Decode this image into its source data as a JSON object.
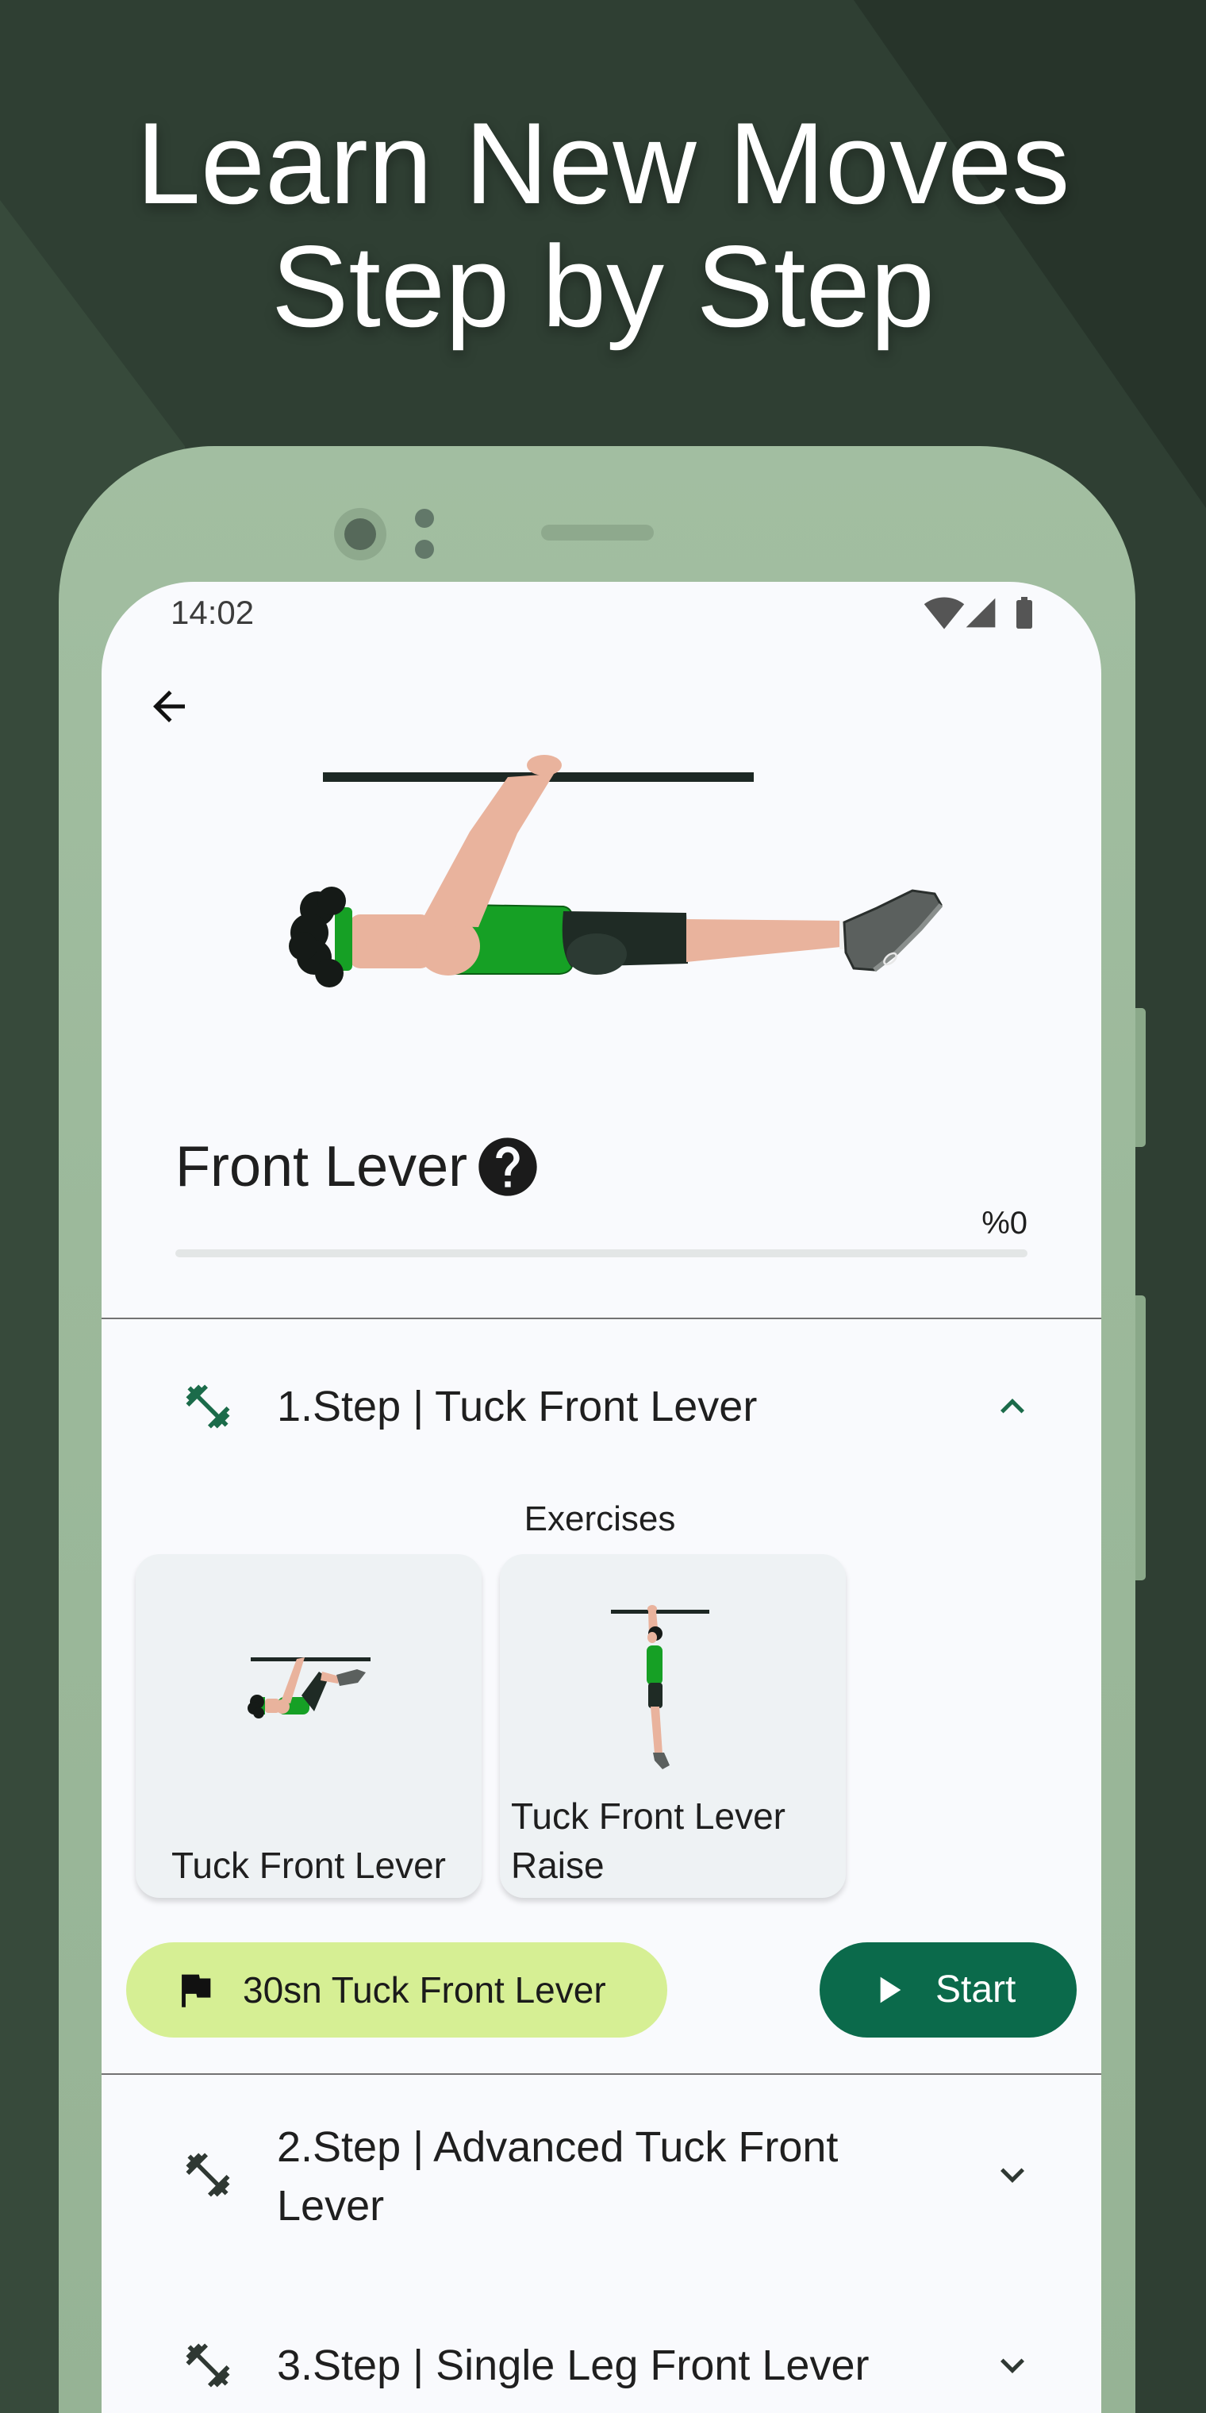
{
  "headline": {
    "line1": "Learn New Moves",
    "line2": "Step by Step"
  },
  "status_bar": {
    "time": "14:02",
    "icons": [
      "wifi-icon",
      "cellular-signal-icon",
      "battery-icon"
    ]
  },
  "toolbar": {
    "back_icon": "arrow-back-icon"
  },
  "skill": {
    "title": "Front Lever",
    "help_icon": "help-circle-icon",
    "progress_label": "%0",
    "progress": 0
  },
  "steps": [
    {
      "label": "1.Step | Tuck Front Lever",
      "icon": "dumbbell-icon",
      "expanded": true,
      "toggle_icon": "chevron-up-icon",
      "exercises_heading": "Exercises",
      "exercises": [
        {
          "label": "Tuck Front Lever"
        },
        {
          "label": "Tuck Front Lever Raise"
        }
      ],
      "goal": {
        "icon": "flag-icon",
        "label": "30sn Tuck Front Lever"
      },
      "start": {
        "icon": "play-icon",
        "label": "Start"
      }
    },
    {
      "label": "2.Step | Advanced Tuck Front Lever",
      "icon": "dumbbell-icon",
      "expanded": false,
      "toggle_icon": "chevron-down-icon"
    },
    {
      "label": "3.Step | Single Leg Front Lever",
      "icon": "dumbbell-icon",
      "expanded": false,
      "toggle_icon": "chevron-down-icon"
    }
  ],
  "colors": {
    "background": "#2e3d31",
    "phone_frame": "#9cb99b",
    "screen": "#f9fafd",
    "accent": "#0b6a4b",
    "goal_chip": "#d6ef94",
    "card": "#eef2f4",
    "text": "#1f1f1f"
  }
}
